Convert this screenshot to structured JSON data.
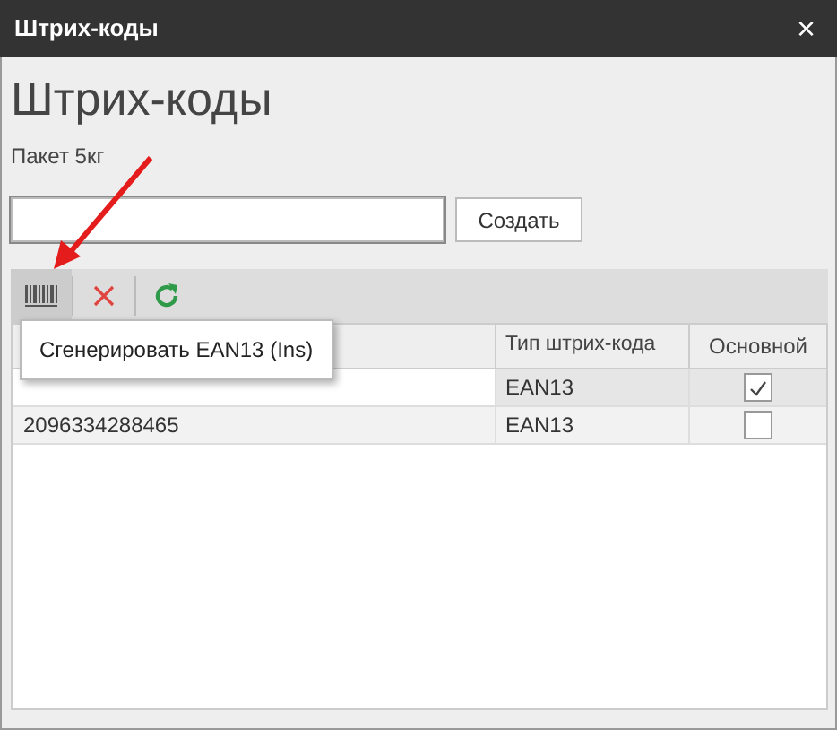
{
  "window": {
    "title": "Штрих-коды",
    "close": "×"
  },
  "heading": "Штрих-коды",
  "subtitle": "Пакет 5кг",
  "barcode_field": {
    "focused": true
  },
  "create_button": "Создать",
  "toolbar": [
    {
      "kind": "generate",
      "selected": true
    },
    {
      "kind": "delete",
      "selected": false
    },
    {
      "kind": "refresh",
      "selected": false
    }
  ],
  "tooltip": "Сгенерировать EAN13 (Ins)",
  "table": {
    "columns": [
      "Тип штрих-кода",
      "Основной"
    ],
    "rows": [
      {
        "type": "EAN13",
        "main": true,
        "selected": true
      },
      {
        "code": "2096334288465",
        "type": "EAN13",
        "main": false,
        "selected": false
      }
    ]
  }
}
